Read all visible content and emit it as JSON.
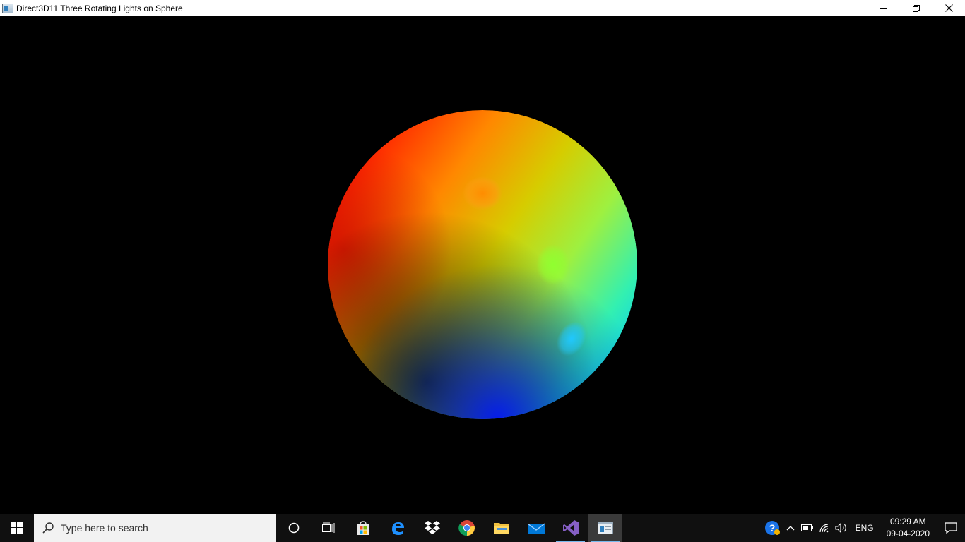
{
  "window": {
    "title": "Direct3D11 Three Rotating Lights on Sphere",
    "icon": "app-window-icon",
    "controls": [
      "minimize-icon",
      "restore-icon",
      "close-icon"
    ]
  },
  "scene": {
    "background": "#000000",
    "object": "sphere",
    "lights": [
      {
        "color": "#ff0000"
      },
      {
        "color": "#00ff00"
      },
      {
        "color": "#0000ff"
      }
    ]
  },
  "taskbar": {
    "search_placeholder": "Type here to search",
    "apps": [
      "cortana-icon",
      "task-view-icon",
      "microsoft-store-icon",
      "edge-icon",
      "dropbox-icon",
      "chrome-icon",
      "file-explorer-icon",
      "mail-icon",
      "visual-studio-icon",
      "direct3d-app-icon"
    ],
    "tray": {
      "language": "ENG",
      "time": "09:29 AM",
      "date": "09-04-2020"
    }
  }
}
